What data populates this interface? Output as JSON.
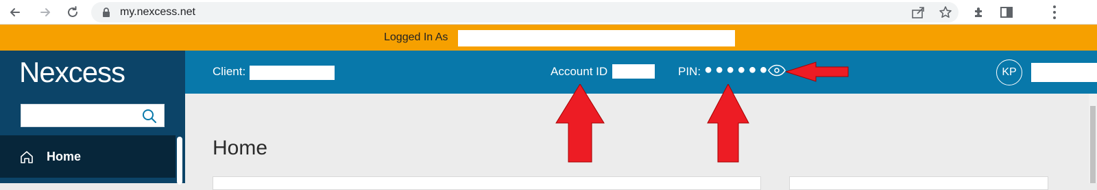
{
  "browser": {
    "url": "my.nexcess.net",
    "icons": [
      "back-arrow-icon",
      "forward-arrow-icon",
      "reload-icon",
      "lock-icon",
      "share-icon",
      "star-icon",
      "extensions-icon",
      "sidebar-icon",
      "menu-icon"
    ]
  },
  "impersonation": {
    "label": "Logged In As"
  },
  "sidebar": {
    "logo": "Nexcess",
    "search_placeholder": "",
    "items": [
      {
        "label": "Home",
        "icon": "home-icon",
        "active": true
      }
    ]
  },
  "header": {
    "client_label": "Client:",
    "account_label": "Account ID",
    "pin_label": "PIN:",
    "pin_dots": "●●●●●●",
    "avatar_initials": "KP"
  },
  "main": {
    "title": "Home"
  },
  "colors": {
    "impersonation_bar": "#f6a000",
    "sidebar": "#0c4468",
    "sidebar_active": "#07263a",
    "header": "#0878aa",
    "annotation_arrow": "#ed1c24"
  }
}
